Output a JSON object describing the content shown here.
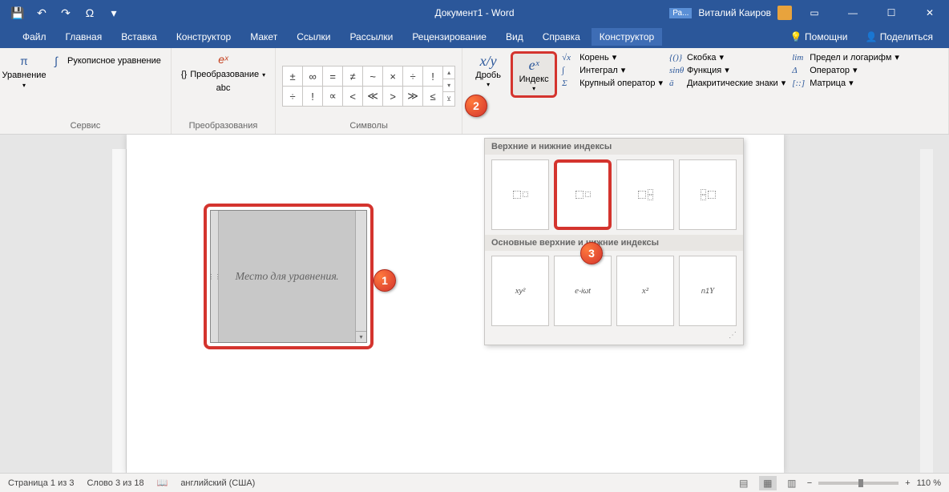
{
  "title": "Документ1 - Word",
  "user": "Виталий Каиров",
  "share_badge": "Ра...",
  "qat": {
    "save": "💾",
    "undo": "↶",
    "redo": "↷",
    "omega": "Ω"
  },
  "tabs": [
    "Файл",
    "Главная",
    "Вставка",
    "Конструктор",
    "Макет",
    "Ссылки",
    "Рассылки",
    "Рецензирование",
    "Вид",
    "Справка"
  ],
  "context_tab": "Конструктор",
  "help_btn": "Помощни",
  "share_btn": "Поделиться",
  "ribbon": {
    "service": {
      "label": "Сервис",
      "equation": "Уравнение",
      "ink": "Рукописное уравнение"
    },
    "transform": {
      "label": "Преобразования",
      "btn": "Преобразование",
      "abc": "abc"
    },
    "symbols": {
      "label": "Символы",
      "row1": [
        "±",
        "∞",
        "=",
        "≠",
        "~",
        "×",
        "÷",
        "!"
      ],
      "row2": [
        "÷",
        "!",
        "∝",
        "<",
        "≪",
        ">",
        "≫",
        "≤"
      ]
    },
    "structures": {
      "fraction": "Дробь",
      "index": "Индекс",
      "root": "Корень",
      "integral": "Интеграл",
      "large_op": "Крупный оператор",
      "bracket": "Скобка",
      "function": "Функция",
      "diacritic": "Диакритические знаки",
      "limit": "Предел и логарифм",
      "operator": "Оператор",
      "matrix": "Матрица"
    }
  },
  "equation_placeholder": "Место для уравнения.",
  "gallery": {
    "header1": "Верхние и нижние индексы",
    "header2": "Основные верхние и нижние индексы",
    "common": [
      "x_{y²}",
      "e^{-iωt}",
      "x²",
      "ⁿ₁Y"
    ]
  },
  "markers": [
    "1",
    "2",
    "3"
  ],
  "status": {
    "page": "Страница 1 из 3",
    "words": "Слово 3 из 18",
    "lang": "английский (США)",
    "zoom": "110 %"
  }
}
